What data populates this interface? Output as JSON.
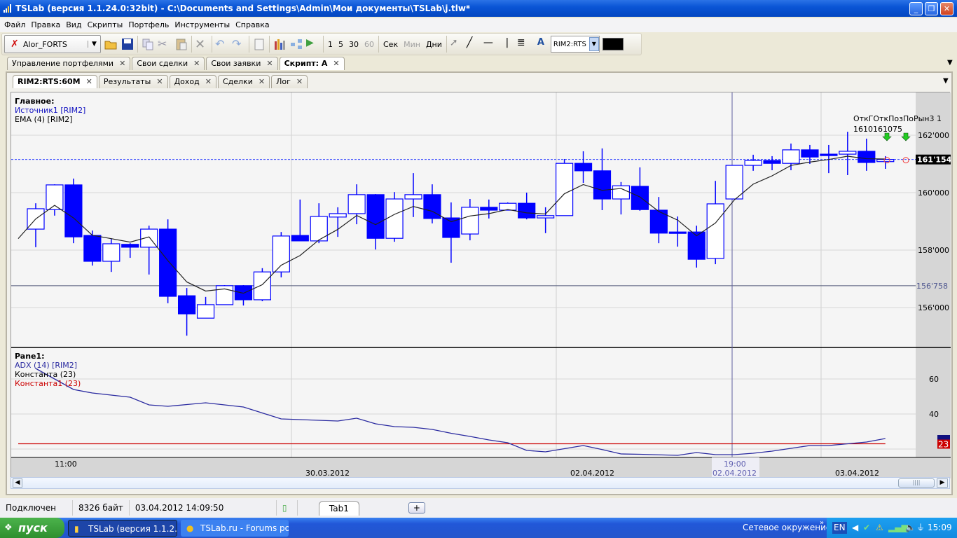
{
  "window": {
    "title": "TSLab (версия 1.1.24.0:32bit) - C:\\Documents and Settings\\Admin\\Мои документы\\TSLab\\j.tlw*"
  },
  "menu": [
    "Файл",
    "Правка",
    "Вид",
    "Скрипты",
    "Портфель",
    "Инструменты",
    "Справка"
  ],
  "toolbar": {
    "broker": "Alor_FORTS",
    "timeframes": [
      "1",
      "5",
      "30",
      "60"
    ],
    "units": [
      "Сек",
      "Мин",
      "Дни"
    ],
    "symbol": "RIM2:RTS"
  },
  "outer_tabs": [
    "Управление портфелями",
    "Свои сделки",
    "Свои заявки",
    "Скрипт: A"
  ],
  "inner_tabs": [
    "RIM2:RTS:60M",
    "Результаты",
    "Доход",
    "Сделки",
    "Лог"
  ],
  "main_pane": {
    "title": "Главное:",
    "legend": [
      "Источник1 [RIM2]",
      "EMA (4) [RIM2]"
    ],
    "y_ticks": [
      {
        "v": 162000,
        "label": "162'000"
      },
      {
        "v": 160000,
        "label": "160'000"
      },
      {
        "v": 158000,
        "label": "158'000"
      },
      {
        "v": 156000,
        "label": "156'000"
      }
    ],
    "last_price": 161154,
    "last_price_label": "161'154",
    "hline": 156758,
    "hline_label": "156'758",
    "signal_text": [
      "ОткГОткПозПоРын3 1",
      "1610161075"
    ],
    "ema_period": 4,
    "candles": [
      [
        158730,
        159630,
        158100,
        159440
      ],
      [
        159410,
        160290,
        159200,
        160270
      ],
      [
        160270,
        160490,
        158240,
        158460
      ],
      [
        158510,
        158680,
        157460,
        157610
      ],
      [
        157610,
        158410,
        157240,
        158220
      ],
      [
        158200,
        158240,
        157730,
        158100
      ],
      [
        158100,
        158850,
        157150,
        158730
      ],
      [
        158730,
        159070,
        156150,
        156390
      ],
      [
        156410,
        156680,
        155020,
        155780
      ],
      [
        155630,
        156370,
        155630,
        156100
      ],
      [
        156100,
        156780,
        156100,
        156760
      ],
      [
        156760,
        156780,
        156070,
        156270
      ],
      [
        156270,
        157370,
        156220,
        157240
      ],
      [
        157240,
        158630,
        157050,
        158490
      ],
      [
        158510,
        159760,
        158320,
        158320
      ],
      [
        158320,
        159630,
        158240,
        159170
      ],
      [
        159150,
        159490,
        158460,
        159270
      ],
      [
        159270,
        160290,
        158900,
        159930
      ],
      [
        159930,
        159950,
        158020,
        158410
      ],
      [
        158410,
        160020,
        158290,
        159780
      ],
      [
        159780,
        160680,
        159150,
        159930
      ],
      [
        159930,
        160290,
        158930,
        159100
      ],
      [
        159120,
        159660,
        157560,
        158440
      ],
      [
        158560,
        159780,
        158340,
        159490
      ],
      [
        159490,
        159760,
        159100,
        159390
      ],
      [
        159390,
        159660,
        159390,
        159630
      ],
      [
        159630,
        160000,
        159070,
        159120
      ],
      [
        159120,
        159490,
        158590,
        159200
      ],
      [
        159200,
        161170,
        159200,
        161020
      ],
      [
        161020,
        161440,
        160340,
        160760
      ],
      [
        160760,
        161540,
        159390,
        159780
      ],
      [
        159780,
        160370,
        159240,
        160240
      ],
      [
        160220,
        160880,
        159370,
        159410
      ],
      [
        159390,
        159850,
        158240,
        158590
      ],
      [
        158630,
        159170,
        158120,
        158590
      ],
      [
        158630,
        158850,
        157390,
        157680
      ],
      [
        157710,
        160410,
        157510,
        159610
      ],
      [
        159780,
        160950,
        159780,
        160950
      ],
      [
        160950,
        161320,
        160760,
        161120
      ],
      [
        161120,
        161270,
        160780,
        161020
      ],
      [
        161020,
        161710,
        160780,
        161490
      ],
      [
        161490,
        161660,
        161000,
        161240
      ],
      [
        161340,
        161660,
        160680,
        161290
      ],
      [
        161340,
        162120,
        160610,
        161440
      ],
      [
        161440,
        161880,
        160760,
        161050
      ],
      [
        161080,
        161270,
        160830,
        161154
      ]
    ]
  },
  "adx_pane": {
    "title": "Pane1:",
    "legend": [
      "ADX (14) [RIM2]",
      "Константа (23)",
      "Константа1 (23)"
    ],
    "y_ticks": [
      {
        "v": 60,
        "label": "60"
      },
      {
        "v": 40,
        "label": "40"
      },
      {
        "v": 20,
        "label": ""
      }
    ],
    "adx": [
      66,
      60,
      54,
      52,
      50.8,
      49.6,
      45.2,
      44.4,
      45.4,
      46.4,
      45.2,
      44,
      40.6,
      37.2,
      36.8,
      36.4,
      36,
      37.6,
      34.4,
      32.8,
      32.4,
      31.2,
      29,
      27.2,
      25.2,
      23.6,
      19.2,
      18.4,
      20.2,
      22,
      19.7,
      17.2,
      17,
      16.7,
      16.4,
      18,
      16.8,
      16.8,
      17.6,
      18.8,
      20.4,
      22,
      22,
      23,
      24,
      26
    ],
    "constant": 23,
    "adx_label": "26",
    "const_label": "23"
  },
  "time_axis": {
    "labels": [
      "11:00",
      "30.03.2012",
      "02.04.2012",
      "03.04.2012"
    ],
    "crosshair_time": "19:00",
    "crosshair_date": "02.04.2012"
  },
  "colors": {
    "candle": "#0000ff",
    "ema": "#202020",
    "adx": "#2a2aa0",
    "constant": "#cc0000",
    "arrow": "#22cc22"
  },
  "statusbar": {
    "connection": "Подключен",
    "bytes": "8326 байт",
    "datetime": "03.04.2012 14:09:50",
    "tab": "Tab1",
    "add": "+"
  },
  "taskbar": {
    "start": "пуск",
    "tasks": [
      "TSLab (версия 1.1.2...",
      "TSLab.ru - Forums po..."
    ],
    "network": "Сетевое окружение",
    "lang": "EN",
    "clock": "15:09"
  }
}
